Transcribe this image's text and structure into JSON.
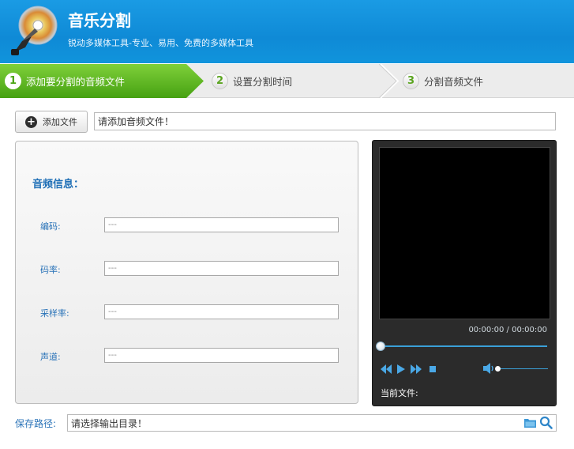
{
  "header": {
    "title": "音乐分割",
    "subtitle": "锐动多媒体工具-专业、易用、免费的多媒体工具"
  },
  "steps": [
    {
      "number": "1",
      "label": "添加要分割的音频文件",
      "active": true
    },
    {
      "number": "2",
      "label": "设置分割时间",
      "active": false
    },
    {
      "number": "3",
      "label": "分割音频文件",
      "active": false
    }
  ],
  "add_file": {
    "button_label": "添加文件",
    "input_value": "请添加音频文件！"
  },
  "info": {
    "title": "音频信息：",
    "fields": [
      {
        "label": "编码:",
        "value": "---"
      },
      {
        "label": "码率:",
        "value": "---"
      },
      {
        "label": "采样率:",
        "value": "---"
      },
      {
        "label": "声道:",
        "value": "---"
      }
    ]
  },
  "player": {
    "time": "00:00:00 / 00:00:00",
    "current_file_label": "当前文件:",
    "progress": 0,
    "volume": 0
  },
  "save": {
    "label": "保存路径:",
    "input_value": "请选择输出目录！"
  },
  "colors": {
    "header": "#1a9be4",
    "active_step": "#5bb51c",
    "link_blue": "#2a73b8",
    "player_bg": "#2b2b2b",
    "player_accent": "#3aa0d8"
  },
  "icons": [
    "music-disc-logo-icon",
    "plus-circle-icon",
    "rewind-icon",
    "play-icon",
    "fast-forward-icon",
    "stop-icon",
    "volume-icon",
    "folder-icon",
    "search-icon"
  ]
}
